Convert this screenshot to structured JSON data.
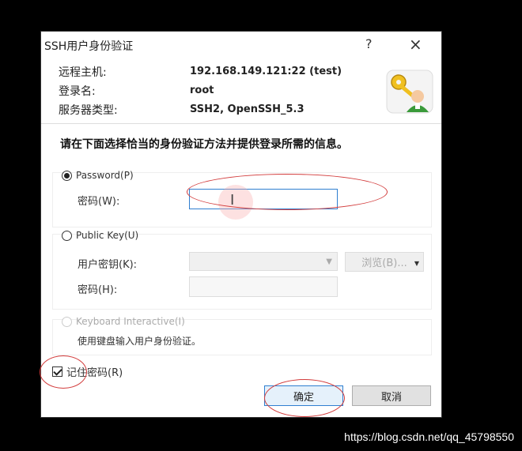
{
  "window": {
    "title": "SSH用户身份验证",
    "help": "?",
    "close": "×"
  },
  "info": {
    "host_label": "远程主机:",
    "host_value": "192.168.149.121:22 (test)",
    "login_label": "登录名:",
    "login_value": "root",
    "server_label": "服务器类型:",
    "server_value": "SSH2, OpenSSH_5.3"
  },
  "instruction": "请在下面选择恰当的身份验证方法并提供登录所需的信息。",
  "password": {
    "radio_label": "Password(P)",
    "field_label": "密码(W):",
    "value": ""
  },
  "publickey": {
    "radio_label": "Public Key(U)",
    "user_key_label": "用户密钥(K):",
    "browse_label": "浏览(B)...",
    "passphrase_label": "密码(H):"
  },
  "keyboard": {
    "radio_label": "Keyboard Interactive(I)",
    "description": "使用键盘输入用户身份验证。"
  },
  "remember": {
    "label": "记住密码(R)"
  },
  "buttons": {
    "ok": "确定",
    "cancel": "取消"
  },
  "watermark": "https://blog.csdn.net/qq_45798550",
  "colors": {
    "annotation": "#d23a3a",
    "focus": "#2f7fd0"
  }
}
